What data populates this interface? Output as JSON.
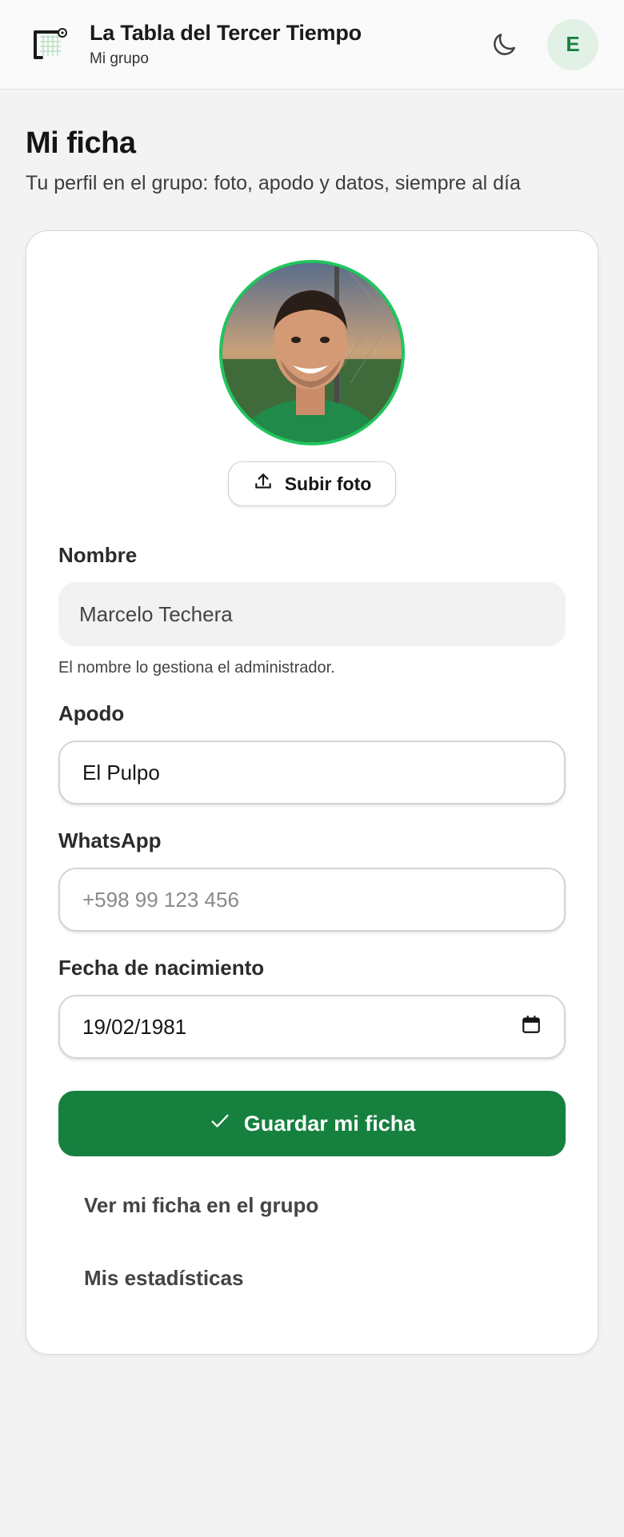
{
  "header": {
    "title": "La Tabla del Tercer Tiempo",
    "subtitle": "Mi grupo",
    "user_initial": "E",
    "icons": {
      "logo": "goal-net-logo",
      "theme": "moon-icon"
    }
  },
  "page": {
    "title": "Mi ficha",
    "subtitle": "Tu perfil en el grupo: foto, apodo y datos, siempre al día"
  },
  "profile": {
    "upload_label": "Subir foto",
    "name": {
      "label": "Nombre",
      "value": "Marcelo Techera",
      "hint": "El nombre lo gestiona el administrador."
    },
    "nickname": {
      "label": "Apodo",
      "value": "El Pulpo"
    },
    "whatsapp": {
      "label": "WhatsApp",
      "value": "",
      "placeholder": "+598 99 123 456"
    },
    "birthdate": {
      "label": "Fecha de nacimiento",
      "value": "19/02/1981"
    },
    "save_label": "Guardar mi ficha",
    "links": [
      {
        "label": "Ver mi ficha en el grupo"
      },
      {
        "label": "Mis estadísticas"
      }
    ]
  },
  "colors": {
    "accent": "#16803f",
    "avatar_ring": "#22c55e",
    "avatar_bg": "#e2f1e6"
  }
}
